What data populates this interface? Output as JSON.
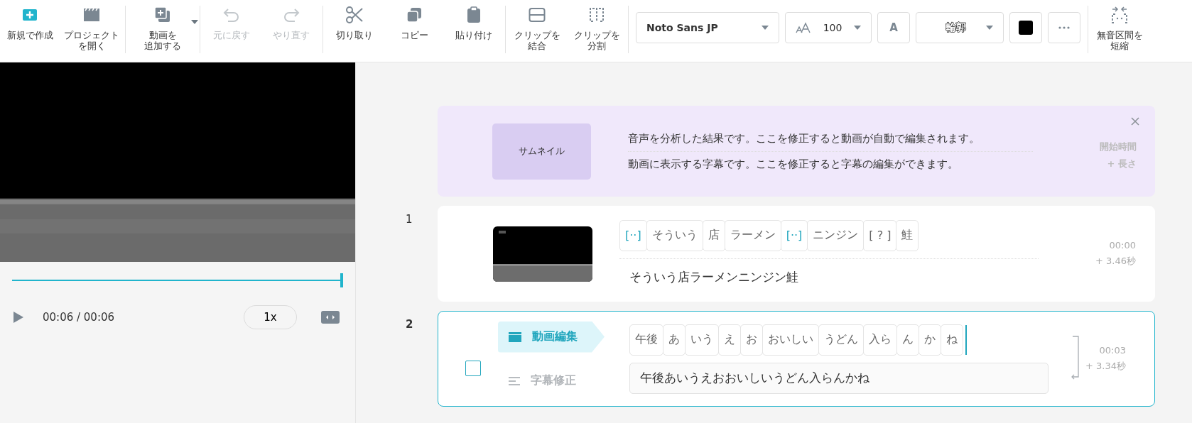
{
  "toolbar": {
    "groups": [
      [
        {
          "label": "新規で作成",
          "disabled": false,
          "dropdown": false
        },
        {
          "label": "プロジェクトを開く",
          "disabled": false,
          "dropdown": false
        }
      ],
      [
        {
          "label": "動画を追加する",
          "disabled": false,
          "dropdown": true
        }
      ],
      [
        {
          "label": "元に戻す",
          "disabled": true,
          "dropdown": false
        },
        {
          "label": "やり直す",
          "disabled": true,
          "dropdown": false
        }
      ],
      [
        {
          "label": "切り取り",
          "disabled": false,
          "dropdown": false
        },
        {
          "label": "コピー",
          "disabled": false,
          "dropdown": false
        },
        {
          "label": "貼り付け",
          "disabled": false,
          "dropdown": false
        }
      ],
      [
        {
          "label": "クリップを結合",
          "disabled": false,
          "dropdown": false
        },
        {
          "label": "クリップを分割",
          "disabled": false,
          "dropdown": false
        }
      ]
    ],
    "font": {
      "family": "Noto Sans JP",
      "size": "100",
      "style_label": "A",
      "outline": "輪郭"
    },
    "shorten_button": {
      "label": "無音区間を短縮"
    }
  },
  "player": {
    "level": 1,
    "time": "00:06 / 00:06",
    "speed": "1x"
  },
  "hint": {
    "thumbnail": "サムネイル",
    "line_1": "音声を分析した結果です。ここを修正すると動画が自動で編集されます。",
    "line_2": "動画に表示する字幕です。ここを修正すると字幕の編集ができます。",
    "start_label": "開始時間",
    "length_label": "+ 長さ"
  },
  "clips": [
    {
      "number": "1",
      "selected": false,
      "tokens": [
        {
          "text": "[··]",
          "kind": "silence"
        },
        {
          "text": "そういう",
          "kind": "word"
        },
        {
          "text": "店",
          "kind": "word"
        },
        {
          "text": "ラーメン",
          "kind": "word"
        },
        {
          "text": "[··]",
          "kind": "silence"
        },
        {
          "text": "ニンジン",
          "kind": "word"
        },
        {
          "text": "[ ? ]",
          "kind": "unknown"
        },
        {
          "text": "鮭",
          "kind": "word"
        }
      ],
      "subtitle": "そういう店ラーメンニンジン鮭",
      "start": "00:00",
      "duration": "+  3.46秒"
    },
    {
      "number": "2",
      "selected": true,
      "checked": false,
      "modes": [
        {
          "label": "動画編集",
          "selected": true
        },
        {
          "label": "字幕修正",
          "selected": false
        }
      ],
      "tokens": [
        {
          "text": "午後",
          "kind": "word"
        },
        {
          "text": "あ",
          "kind": "word"
        },
        {
          "text": "いう",
          "kind": "word"
        },
        {
          "text": "え",
          "kind": "word"
        },
        {
          "text": "お",
          "kind": "word"
        },
        {
          "text": "おいしい",
          "kind": "word"
        },
        {
          "text": "うどん",
          "kind": "word"
        },
        {
          "text": "入ら",
          "kind": "word"
        },
        {
          "text": "ん",
          "kind": "word"
        },
        {
          "text": "か",
          "kind": "word"
        },
        {
          "text": "ね",
          "kind": "word"
        }
      ],
      "subtitle": "午後あいうえおおいしいうどん入らんかね",
      "start": "00:03",
      "duration": "+  3.34秒"
    }
  ]
}
